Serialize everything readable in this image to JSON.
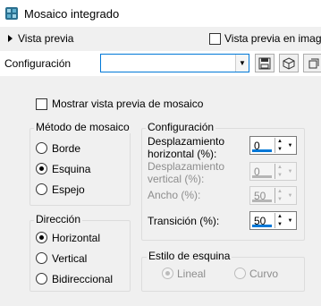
{
  "window": {
    "title": "Mosaico integrado",
    "icon": "app-icon"
  },
  "preview": {
    "toggle_label": "Vista previa",
    "image_preview_label": "Vista previa en imagen",
    "image_preview_checked": false
  },
  "config": {
    "label": "Configuración",
    "preset_value": "",
    "buttons": [
      {
        "name": "save-icon"
      },
      {
        "name": "presets-icon"
      },
      {
        "name": "reset-icon"
      }
    ]
  },
  "main": {
    "show_preview_label": "Mostrar vista previa de mosaico",
    "show_preview_checked": false,
    "method": {
      "title": "Método de mosaico",
      "options": [
        "Borde",
        "Esquina",
        "Espejo"
      ],
      "selected": "Esquina"
    },
    "direction": {
      "title": "Dirección",
      "options": [
        "Horizontal",
        "Vertical",
        "Bidireccional"
      ],
      "selected": "Horizontal"
    },
    "settings": {
      "title": "Configuración",
      "h_offset_label": "Desplazamiento horizontal (%):",
      "h_offset_value": "0",
      "v_offset_label": "Desplazamiento vertical (%):",
      "v_offset_value": "0",
      "width_label": "Ancho (%):",
      "width_value": "50",
      "transition_label": "Transición (%):",
      "transition_value": "50"
    },
    "corner_style": {
      "title": "Estilo de esquina",
      "options": [
        "Lineal",
        "Curvo"
      ],
      "selected": "Lineal",
      "disabled": true
    }
  },
  "colors": {
    "accent": "#0078d7",
    "background": "#f0f0f0",
    "disabled": "#8d8d8d"
  }
}
